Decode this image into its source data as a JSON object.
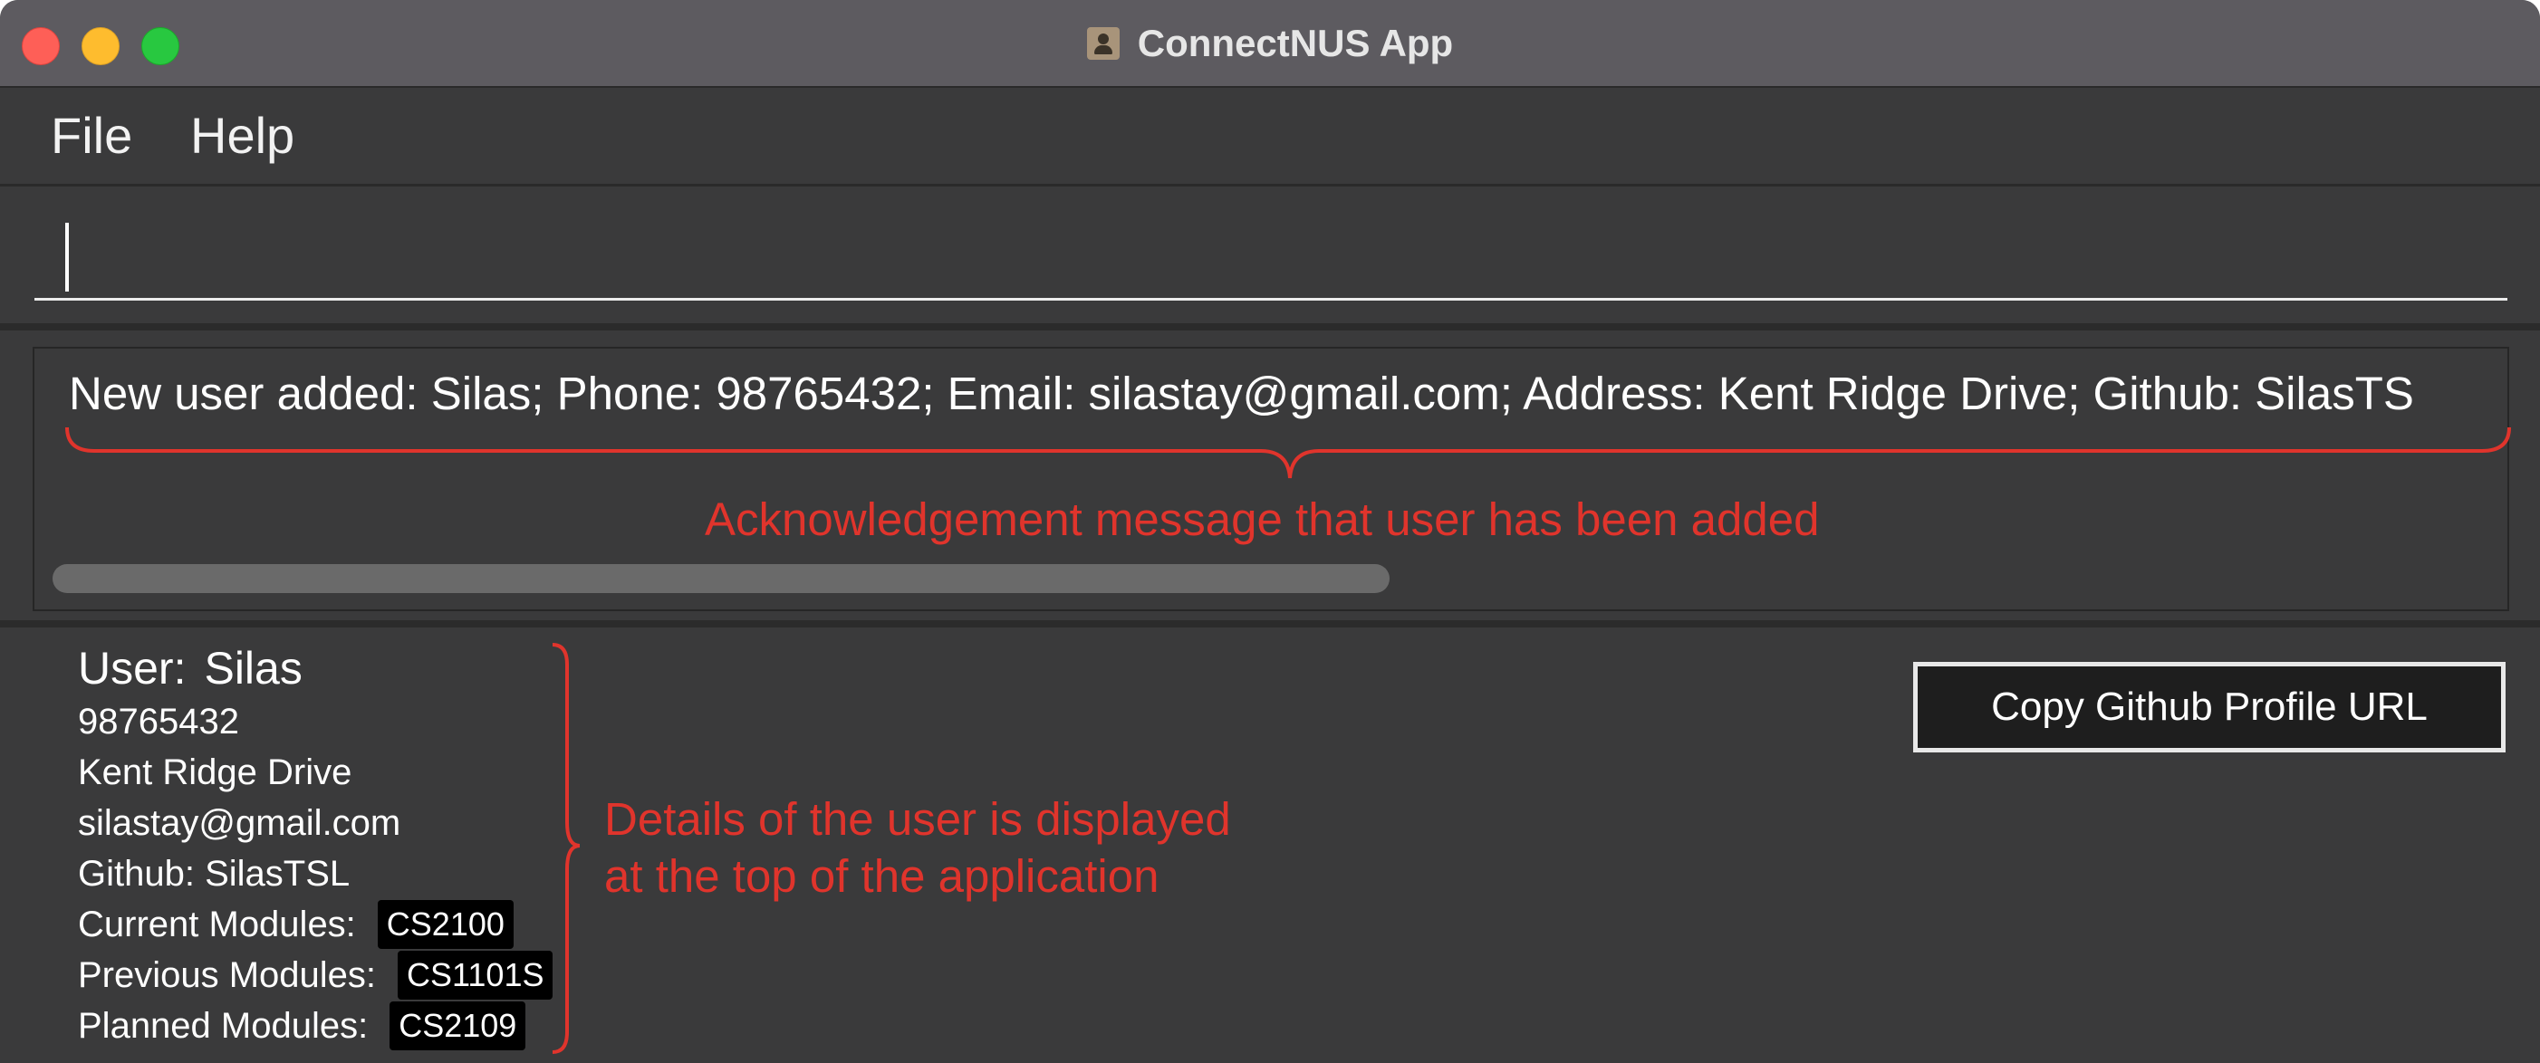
{
  "window": {
    "title": "ConnectNUS App",
    "icon": "contact-card-icon"
  },
  "menu": {
    "items": [
      {
        "label": "File"
      },
      {
        "label": "Help"
      }
    ]
  },
  "command_box": {
    "value": "",
    "placeholder": ""
  },
  "result_display": {
    "message": "New user added: Silas; Phone: 98765432; Email: silastay@gmail.com; Address: Kent Ridge Drive; Github: SilasTS"
  },
  "annotations": {
    "acknowledgement": "Acknowledgement message that user has been added",
    "details_line1": "Details of the user is displayed",
    "details_line2": "at the top of the application"
  },
  "user": {
    "title_label": "User:",
    "name": "Silas",
    "phone": "98765432",
    "address": "Kent Ridge Drive",
    "email": "silastay@gmail.com",
    "github": "Github: SilasTSL",
    "current_modules_label": "Current Modules:",
    "current_modules": [
      "CS2100"
    ],
    "previous_modules_label": "Previous Modules:",
    "previous_modules": [
      "CS1101S"
    ],
    "planned_modules_label": "Planned Modules:",
    "planned_modules": [
      "CS2109"
    ]
  },
  "actions": {
    "copy_github_label": "Copy Github Profile URL"
  },
  "colors": {
    "background": "#3a3a3b",
    "titlebar": "#5d5b60",
    "annotation": "#e0342c",
    "tag_bg": "#000000"
  }
}
